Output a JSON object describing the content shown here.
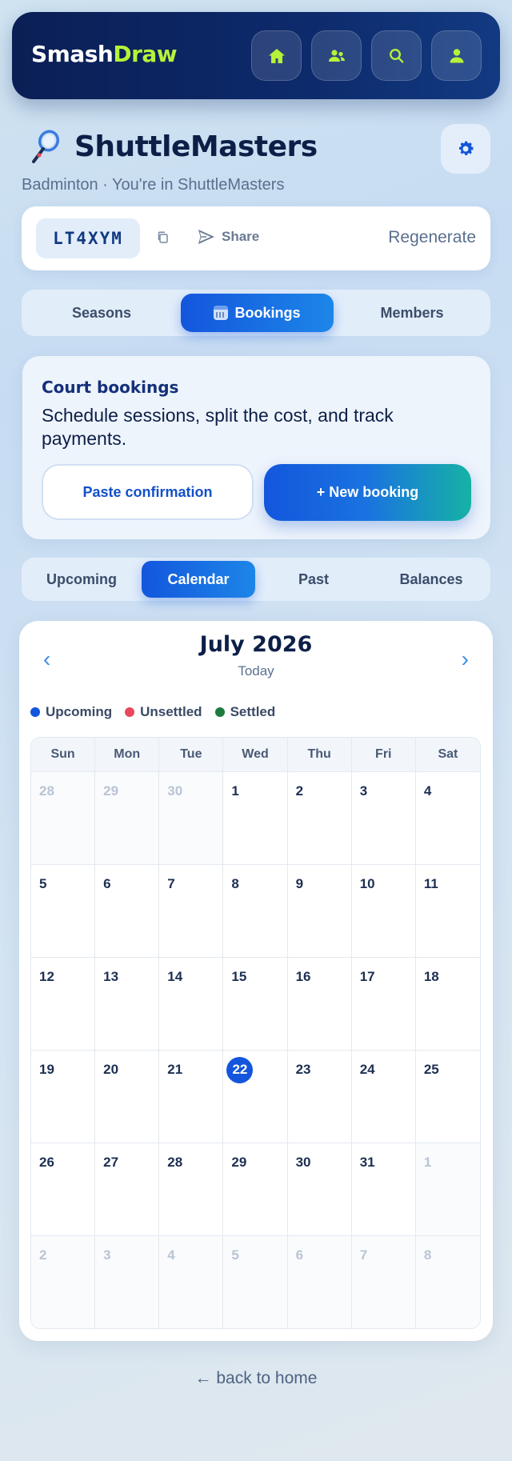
{
  "app": {
    "brand_part1": "Smash",
    "brand_part2": "Draw",
    "nav_icons": [
      "home-icon",
      "group-icon",
      "search-icon",
      "user-icon"
    ],
    "accent_color": "#b6f23a"
  },
  "club": {
    "title": "ShuttleMasters",
    "subtitle": "Badminton · You're in ShuttleMasters",
    "icon": "badminton-racket-icon",
    "settings_icon": "gear-icon"
  },
  "invite": {
    "code": "LT4XYM",
    "share_label": "Share",
    "regenerate_label": "Regenerate"
  },
  "main_tabs": [
    {
      "label": "Seasons",
      "active": false
    },
    {
      "label": "Bookings",
      "active": true
    },
    {
      "label": "Members",
      "active": false
    }
  ],
  "bookings": {
    "title": "Court bookings",
    "description": "Schedule sessions, split the cost, and track payments.",
    "paste_label": "Paste confirmation",
    "new_label": "+ New booking"
  },
  "sub_tabs": [
    {
      "label": "Upcoming",
      "active": false
    },
    {
      "label": "Calendar",
      "active": true
    },
    {
      "label": "Past",
      "active": false
    },
    {
      "label": "Balances",
      "active": false
    }
  ],
  "calendar": {
    "month_label": "July 2026",
    "today_label": "Today",
    "prev_glyph": "‹",
    "next_glyph": "›",
    "legend": [
      {
        "label": "Upcoming",
        "color": "#1356dd"
      },
      {
        "label": "Unsettled",
        "color": "#e8485a"
      },
      {
        "label": "Settled",
        "color": "#1f7a3e"
      }
    ],
    "weekdays": [
      "Sun",
      "Mon",
      "Tue",
      "Wed",
      "Thu",
      "Fri",
      "Sat"
    ],
    "days": [
      {
        "d": "28",
        "out": true
      },
      {
        "d": "29",
        "out": true
      },
      {
        "d": "30",
        "out": true
      },
      {
        "d": "1"
      },
      {
        "d": "2"
      },
      {
        "d": "3"
      },
      {
        "d": "4"
      },
      {
        "d": "5"
      },
      {
        "d": "6"
      },
      {
        "d": "7"
      },
      {
        "d": "8"
      },
      {
        "d": "9"
      },
      {
        "d": "10"
      },
      {
        "d": "11"
      },
      {
        "d": "12"
      },
      {
        "d": "13"
      },
      {
        "d": "14"
      },
      {
        "d": "15"
      },
      {
        "d": "16"
      },
      {
        "d": "17"
      },
      {
        "d": "18"
      },
      {
        "d": "19"
      },
      {
        "d": "20"
      },
      {
        "d": "21"
      },
      {
        "d": "22",
        "today": true
      },
      {
        "d": "23"
      },
      {
        "d": "24"
      },
      {
        "d": "25"
      },
      {
        "d": "26"
      },
      {
        "d": "27"
      },
      {
        "d": "28"
      },
      {
        "d": "29"
      },
      {
        "d": "30"
      },
      {
        "d": "31"
      },
      {
        "d": "1",
        "out": true
      },
      {
        "d": "2",
        "out": true
      },
      {
        "d": "3",
        "out": true
      },
      {
        "d": "4",
        "out": true
      },
      {
        "d": "5",
        "out": true
      },
      {
        "d": "6",
        "out": true
      },
      {
        "d": "7",
        "out": true
      },
      {
        "d": "8",
        "out": true
      }
    ]
  },
  "footer": {
    "back_label": "← back to home"
  }
}
